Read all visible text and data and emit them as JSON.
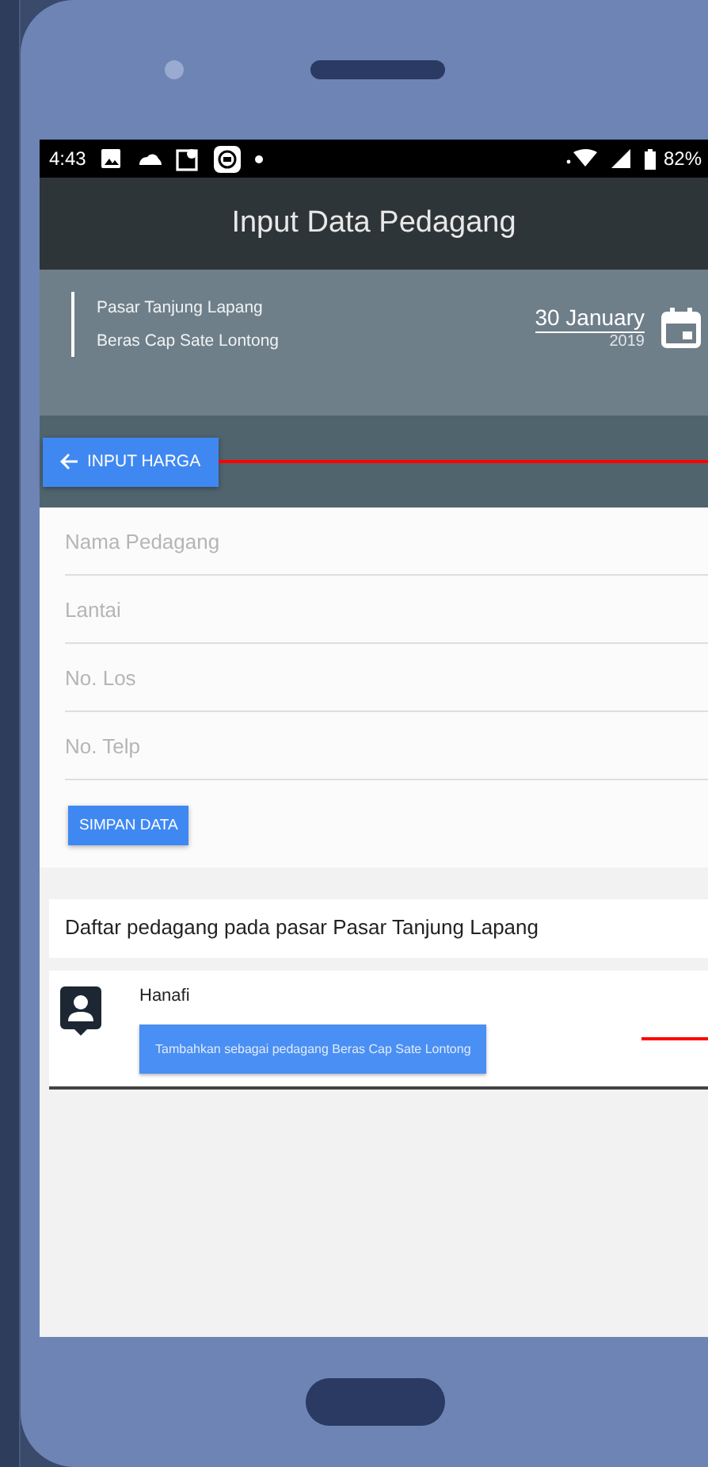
{
  "status_bar": {
    "time": "4:43",
    "battery": "82%"
  },
  "app_bar": {
    "title": "Input Data Pedagang"
  },
  "info": {
    "market": "Pasar Tanjung Lapang",
    "product": "Beras Cap Sate Lontong",
    "date": "30 January",
    "year": "2019"
  },
  "back_button": {
    "label": "INPUT HARGA"
  },
  "form": {
    "fields": [
      {
        "placeholder": "Nama Pedagang"
      },
      {
        "placeholder": "Lantai"
      },
      {
        "placeholder": "No. Los"
      },
      {
        "placeholder": "No. Telp"
      }
    ],
    "submit": "SIMPAN DATA"
  },
  "list": {
    "heading": "Daftar pedagang pada pasar Pasar Tanjung Lapang",
    "items": [
      {
        "name": "Hanafi",
        "action": "Tambahkan sebagai pedagang Beras Cap Sate Lontong"
      }
    ]
  }
}
